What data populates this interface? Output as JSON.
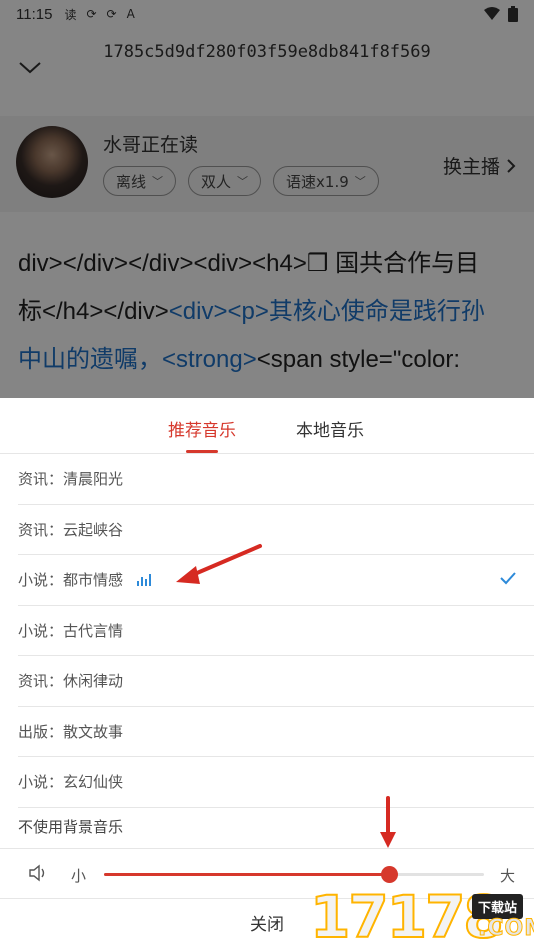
{
  "status": {
    "time": "11:15",
    "icons": [
      "读",
      "⟳",
      "⟳",
      "A"
    ]
  },
  "reader": {
    "doc_title": "1785c5d9df280f03f59e8db841f8f569",
    "anchor_name": "水哥正在读",
    "chips": [
      "离线",
      "双人",
      "语速x1.9"
    ],
    "switch_anchor": "换主播",
    "text_line1": "div></div></div><div><h4>❒ 国共合作与目",
    "text_line2a": "标</h4></div>",
    "text_line2b": "<div><p>其核心使命是践行孙",
    "text_line3a": "中山的遗嘱，<strong>",
    "text_line3b": "<span style=\"color:"
  },
  "sheet": {
    "tabs": [
      "推荐音乐",
      "本地音乐"
    ],
    "active_tab": 0,
    "items": [
      {
        "label": "资讯：清晨阳光"
      },
      {
        "label": "资讯：云起峡谷"
      },
      {
        "label": "小说：都市情感",
        "playing": true,
        "selected": true
      },
      {
        "label": "小说：古代言情"
      },
      {
        "label": "资讯：休闲律动"
      },
      {
        "label": "出版：散文故事"
      },
      {
        "label": "小说：玄幻仙侠"
      }
    ],
    "no_bg_music": "不使用背景音乐",
    "volume": {
      "min_label": "小",
      "max_label": "大",
      "level": 0.75
    },
    "close_label": "关闭"
  },
  "watermark": {
    "text": "17178",
    "badge": "下载站",
    "suffix": ".COM"
  },
  "colors": {
    "accent": "#d6382c",
    "link": "#1f72c8",
    "playing": "#2d8ad9"
  }
}
